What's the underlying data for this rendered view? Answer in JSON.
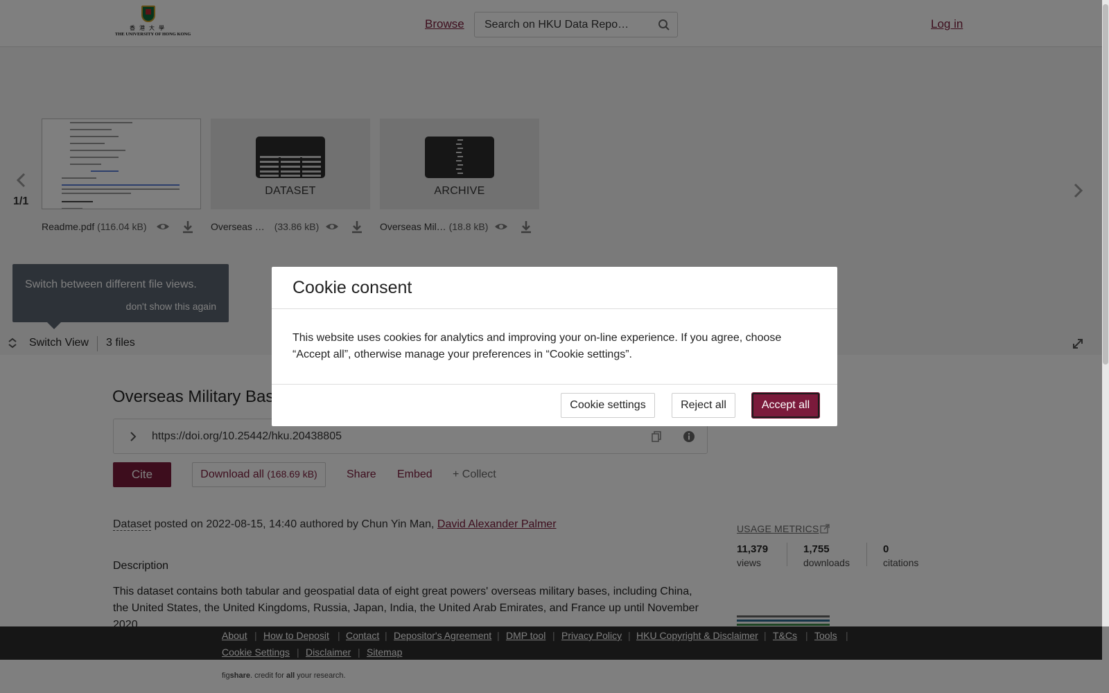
{
  "header": {
    "logo": {
      "name_zh": "香港大學",
      "name_en": "THE UNIVERSITY OF HONG KONG"
    },
    "browse_label": "Browse",
    "search_placeholder": "Search on HKU Data Repo…",
    "login_label": "Log in"
  },
  "carousel": {
    "page_indicator": "1/1",
    "files": [
      {
        "name": "Readme.pdf",
        "size": "(116.04 kB)",
        "preview": "pdf"
      },
      {
        "name": "Overseas …",
        "size": "(33.86 kB)",
        "type_label": "DATASET"
      },
      {
        "name": "Overseas Mil…",
        "size": "(18.8 kB)",
        "type_label": "ARCHIVE"
      }
    ],
    "tooltip": {
      "text": "Switch between different file views.",
      "dismiss": "don't show this again"
    },
    "switch_view_label": "Switch View",
    "file_count": "3 files"
  },
  "item": {
    "title": "Overseas Military Bas",
    "doi": "https://doi.org/10.25442/hku.20438805",
    "cite_label": "Cite",
    "download_all_label": "Download all",
    "download_all_size": "(168.69 kB)",
    "share_label": "Share",
    "embed_label": "Embed",
    "collect_label": "+ Collect",
    "meta": {
      "type": "Dataset",
      "posted_text": " posted on 2022-08-15, 14:40 authored by Chun Yin Man, ",
      "linked_author": "David Alexander Palmer"
    },
    "description_heading": "Description",
    "description": "This dataset contains both tabular and geospatial data of eight great powers' overseas military bases, including China, the United States, the United Kingdoms, Russia, Japan, India, the United Arab Emirates, and France up until November 2020."
  },
  "metrics": {
    "title": "USAGE METRICS",
    "views": {
      "value": "11,379",
      "label": "views"
    },
    "downloads": {
      "value": "1,755",
      "label": "downloads"
    },
    "citations": {
      "value": "0",
      "label": "citations"
    }
  },
  "footer": {
    "links": [
      "About",
      "How to Deposit",
      "Contact",
      "Depositor's Agreement",
      "DMP tool",
      "Privacy Policy",
      "HKU Copyright & Disclaimer",
      "T&Cs",
      "Tools",
      "Cookie Settings",
      "Disclaimer",
      "Sitemap"
    ],
    "credit_fig": "fig",
    "credit_share": "share",
    "credit_mid": ". credit for ",
    "credit_all": "all",
    "credit_end": " your research."
  },
  "cookie_modal": {
    "title": "Cookie consent",
    "body": "This website uses cookies for analytics and improving your on-line experience. If you agree, choose “Accept all”, otherwise manage your preferences in “Cookie settings”.",
    "settings_label": "Cookie settings",
    "reject_label": "Reject all",
    "accept_label": "Accept all"
  },
  "colors": {
    "brand": "#7b1a3b",
    "footer_bg": "#2d2d2d",
    "overlay": "rgba(0,0,0,0.5)"
  }
}
